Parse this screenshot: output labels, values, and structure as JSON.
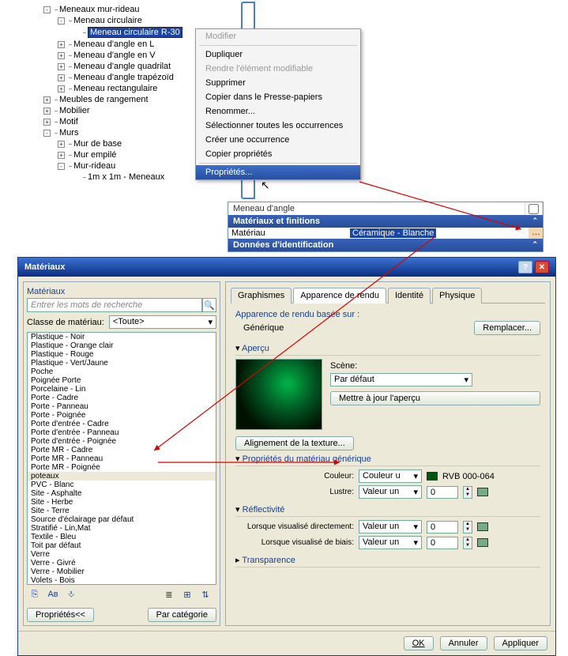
{
  "tree": {
    "items": [
      {
        "toggle": "-",
        "label": "Meneaux mur-rideau",
        "indent": 0
      },
      {
        "toggle": "-",
        "label": "Meneau circulaire",
        "indent": 1
      },
      {
        "toggle": "",
        "label": "Meneau circulaire R-30",
        "indent": 2,
        "selected": true
      },
      {
        "toggle": "+",
        "label": "Meneau d'angle en L",
        "indent": 1
      },
      {
        "toggle": "+",
        "label": "Meneau d'angle en V",
        "indent": 1
      },
      {
        "toggle": "+",
        "label": "Meneau d'angle quadrilat",
        "indent": 1
      },
      {
        "toggle": "+",
        "label": "Meneau d'angle trapézoïd",
        "indent": 1
      },
      {
        "toggle": "+",
        "label": "Meneau rectangulaire",
        "indent": 1
      },
      {
        "toggle": "+",
        "label": "Meubles de rangement",
        "indent": 0
      },
      {
        "toggle": "+",
        "label": "Mobilier",
        "indent": 0
      },
      {
        "toggle": "+",
        "label": "Motif",
        "indent": 0
      },
      {
        "toggle": "-",
        "label": "Murs",
        "indent": 0
      },
      {
        "toggle": "+",
        "label": "Mur de base",
        "indent": 1
      },
      {
        "toggle": "+",
        "label": "Mur empilé",
        "indent": 1
      },
      {
        "toggle": "-",
        "label": "Mur-rideau",
        "indent": 1
      },
      {
        "toggle": "",
        "label": "1m x 1m - Meneaux",
        "indent": 2
      }
    ]
  },
  "context_menu": {
    "items": [
      {
        "label": "Modifier",
        "disabled": true
      },
      {
        "sep": true
      },
      {
        "label": "Dupliquer"
      },
      {
        "label": "Rendre l'élément modifiable",
        "disabled": true
      },
      {
        "label": "Supprimer"
      },
      {
        "label": "Copier dans le Presse-papiers"
      },
      {
        "label": "Renommer..."
      },
      {
        "label": "Sélectionner toutes les occurrences"
      },
      {
        "label": "Créer une occurrence"
      },
      {
        "label": "Copier propriétés"
      },
      {
        "sep": true
      },
      {
        "label": "Propriétés...",
        "selected": true
      }
    ]
  },
  "props": {
    "row_label": "Meneau d'angle",
    "group1": "Matériaux et finitions",
    "param": "Matériau",
    "value": "Céramique - Blanche",
    "group2": "Données d'identification"
  },
  "dialog": {
    "title": "Matériaux",
    "left": {
      "section": "Matériaux",
      "search_placeholder": "Entrer les mots de recherche",
      "class_label": "Classe de matériau:",
      "class_value": "<Toute>",
      "items": [
        "Plastique - Noir",
        "Plastique - Orange clair",
        "Plastique - Rouge",
        "Plastique - Vert/Jaune",
        "Poche",
        "Poignée Porte",
        "Porcelaine - Lin",
        "Porte - Cadre",
        "Porte - Panneau",
        "Porte - Poignée",
        "Porte d'entrée - Cadre",
        "Porte d'entrée - Panneau",
        "Porte d'entrée - Poignée",
        "Porte MR - Cadre",
        "Porte MR - Panneau",
        "Porte MR - Poignée",
        "poteaux",
        "PVC - Blanc",
        "Site - Asphalte",
        "Site - Herbe",
        "Site - Terre",
        "Source d'éclairage par défaut",
        "Stratifié - Lin,Mat",
        "Textile - Bleu",
        "Toit par défaut",
        "Verre",
        "Verre - Givré",
        "Verre - Mobilier",
        "Volets - Bois"
      ],
      "selected_item": "poteaux",
      "props_btn": "Propriétés<<",
      "cat_btn": "Par catégorie"
    },
    "right": {
      "tabs": [
        "Graphismes",
        "Apparence de rendu",
        "Identité",
        "Physique"
      ],
      "active_tab": 1,
      "based_on_label": "Apparence de rendu basée sur :",
      "based_on_value": "Générique",
      "replace_btn": "Remplacer...",
      "preview_label": "Aperçu",
      "scene_label": "Scène:",
      "scene_value": "Par défaut",
      "update_btn": "Mettre à jour l'aperçu",
      "align_btn": "Alignement de la texture...",
      "generic_group": "Propriétés du matériau générique",
      "color_label": "Couleur:",
      "color_sel": "Couleur u",
      "color_rgb": "RVB 000-064",
      "lustre_label": "Lustre:",
      "lustre_sel": "Valeur un",
      "lustre_val": "0",
      "reflect_group": "Réflectivité",
      "direct_label": "Lorsque visualisé directement:",
      "direct_sel": "Valeur un",
      "direct_val": "0",
      "bias_label": "Lorsque visualisé de biais:",
      "bias_sel": "Valeur un",
      "bias_val": "0",
      "trans_group": "Transparence"
    },
    "footer": {
      "ok": "OK",
      "cancel": "Annuler",
      "apply": "Appliquer"
    }
  }
}
